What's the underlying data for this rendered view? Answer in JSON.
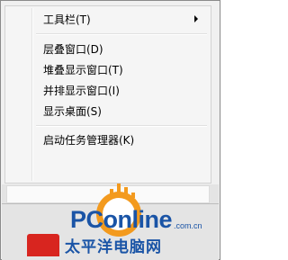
{
  "context_menu": {
    "items": [
      {
        "label": "工具栏(T)",
        "has_submenu": true
      },
      {
        "label": "层叠窗口(D)"
      },
      {
        "label": "堆叠显示窗口(T)"
      },
      {
        "label": "并排显示窗口(I)"
      },
      {
        "label": "显示桌面(S)"
      },
      {
        "label": "启动任务管理器(K)"
      }
    ]
  },
  "watermark": {
    "brand": "PConline",
    "domain": ".com.cn",
    "brand_cn": "太平洋电脑网",
    "colors": {
      "blue": "#1a54a6",
      "orange": "#f39a1e"
    }
  }
}
